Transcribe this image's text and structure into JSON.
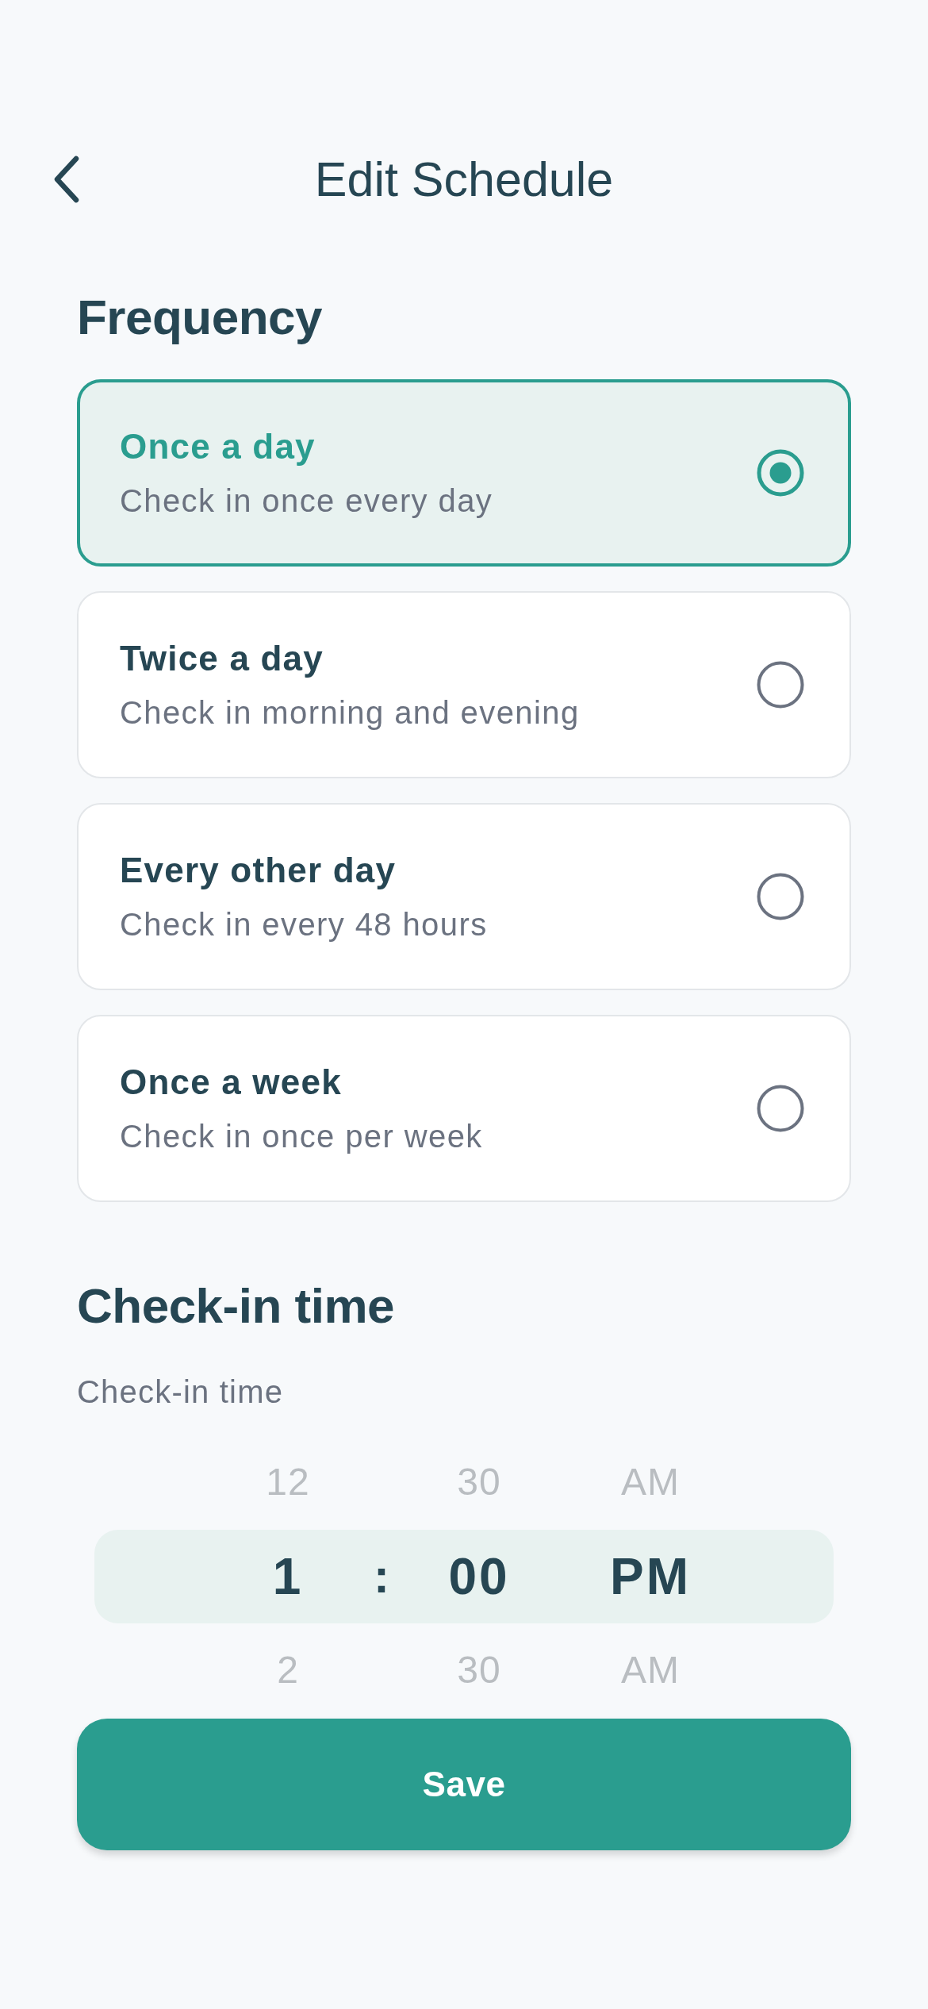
{
  "header": {
    "title": "Edit Schedule"
  },
  "frequency": {
    "heading": "Frequency",
    "options": [
      {
        "title": "Once a day",
        "description": "Check in once every day",
        "selected": true
      },
      {
        "title": "Twice a day",
        "description": "Check in morning and evening",
        "selected": false
      },
      {
        "title": "Every other day",
        "description": "Check in every 48 hours",
        "selected": false
      },
      {
        "title": "Once a week",
        "description": "Check in once per week",
        "selected": false
      }
    ]
  },
  "checkin": {
    "heading": "Check-in time",
    "label": "Check-in time",
    "picker": {
      "columns": [
        {
          "kind": "hour",
          "items": [
            {
              "text": "12",
              "selected": false
            },
            {
              "text": "1",
              "selected": true
            },
            {
              "text": "2",
              "selected": false
            }
          ]
        },
        {
          "kind": "separator",
          "text": ":"
        },
        {
          "kind": "minute",
          "items": [
            {
              "text": "30",
              "selected": false
            },
            {
              "text": "00",
              "selected": true
            },
            {
              "text": "30",
              "selected": false
            }
          ]
        },
        {
          "kind": "period",
          "items": [
            {
              "text": "AM",
              "selected": false
            },
            {
              "text": "PM",
              "selected": true
            },
            {
              "text": "AM",
              "selected": false
            }
          ]
        }
      ]
    }
  },
  "save_button": {
    "label": "Save"
  }
}
